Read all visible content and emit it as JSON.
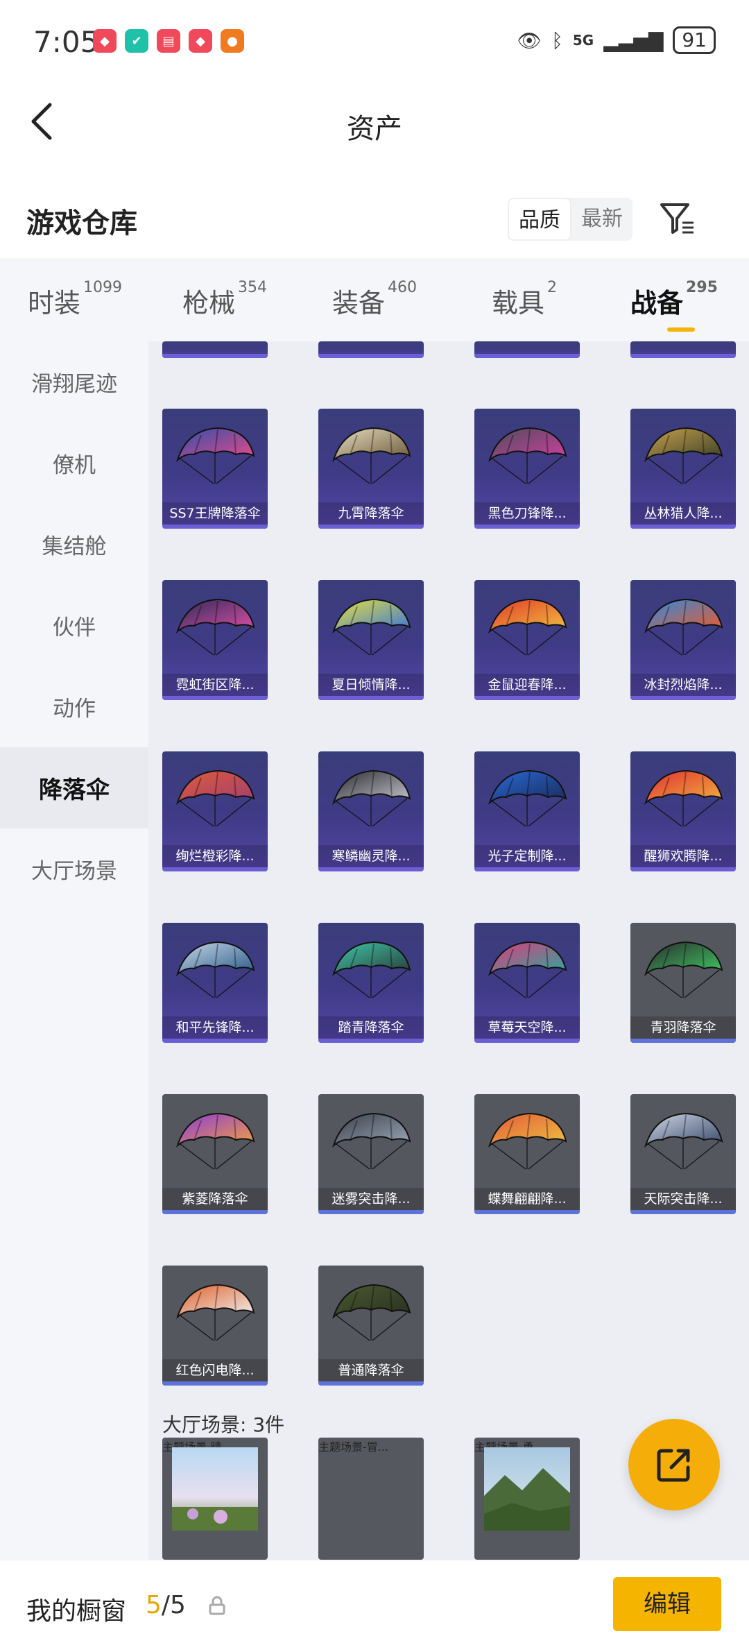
{
  "status": {
    "time": "7:05",
    "network": "5G",
    "battery": "91"
  },
  "nav": {
    "title": "资产"
  },
  "warehouse": {
    "title": "游戏仓库",
    "sort_quality": "品质",
    "sort_newest": "最新"
  },
  "tabs": [
    {
      "label": "时装",
      "count": "1099"
    },
    {
      "label": "枪械",
      "count": "354"
    },
    {
      "label": "装备",
      "count": "460"
    },
    {
      "label": "载具",
      "count": "2"
    },
    {
      "label": "战备",
      "count": "295"
    }
  ],
  "sidebar": [
    "滑翔尾迹",
    "僚机",
    "集结舱",
    "伙伴",
    "动作",
    "降落伞",
    "大厅场景"
  ],
  "items": [
    {
      "name": "SS7王牌降落伞",
      "style": "purple",
      "c1": "#2f4fa8",
      "c2": "#e84b8a"
    },
    {
      "name": "九霄降落伞",
      "style": "purple",
      "c1": "#e8dcc0",
      "c2": "#6b5a3a"
    },
    {
      "name": "黑色刀锋降...",
      "style": "purple",
      "c1": "#4a4f5a",
      "c2": "#d03ea0"
    },
    {
      "name": "丛林猎人降...",
      "style": "purple",
      "c1": "#c8a24a",
      "c2": "#3a3f2a"
    },
    {
      "name": "霓虹街区降...",
      "style": "purple",
      "c1": "#2a2a55",
      "c2": "#e050a8"
    },
    {
      "name": "夏日倾情降...",
      "style": "purple",
      "c1": "#e8e040",
      "c2": "#3a78d8"
    },
    {
      "name": "金鼠迎春降...",
      "style": "purple",
      "c1": "#e03a2a",
      "c2": "#f0c040"
    },
    {
      "name": "冰封烈焰降...",
      "style": "purple",
      "c1": "#2a8ae0",
      "c2": "#f05a2a"
    },
    {
      "name": "绚烂橙彩降...",
      "style": "purple",
      "c1": "#e05a3a",
      "c2": "#a04070"
    },
    {
      "name": "寒鳞幽灵降...",
      "style": "purple",
      "c1": "#2a2a30",
      "c2": "#c8c8d0"
    },
    {
      "name": "光子定制降...",
      "style": "purple",
      "c1": "#2a6ad8",
      "c2": "#1a2a58"
    },
    {
      "name": "醒狮欢腾降...",
      "style": "purple",
      "c1": "#e03030",
      "c2": "#f0b040"
    },
    {
      "name": "和平先锋降...",
      "style": "purple",
      "c1": "#c8d8e8",
      "c2": "#2a5a8a"
    },
    {
      "name": "踏青降落伞",
      "style": "purple",
      "c1": "#40c8a8",
      "c2": "#2a3a3a"
    },
    {
      "name": "草莓天空降...",
      "style": "purple",
      "c1": "#e03a7a",
      "c2": "#2aa8a0"
    },
    {
      "name": "青羽降落伞",
      "style": "gray",
      "c1": "#2a2a30",
      "c2": "#40c860"
    },
    {
      "name": "紫菱降落伞",
      "style": "gray",
      "c1": "#8a3ad8",
      "c2": "#f0a040"
    },
    {
      "name": "迷雾突击降...",
      "style": "gray",
      "c1": "#3a3f48",
      "c2": "#9aa8b8"
    },
    {
      "name": "蝶舞翩翩降...",
      "style": "gray",
      "c1": "#e05a3a",
      "c2": "#f0c040"
    },
    {
      "name": "天际突击降...",
      "style": "gray",
      "c1": "#d0d8e8",
      "c2": "#3a4a6a"
    },
    {
      "name": "红色闪电降...",
      "style": "gray",
      "c1": "#e0602a",
      "c2": "#f0f0f0"
    },
    {
      "name": "普通降落伞",
      "style": "gray",
      "c1": "#4a5a30",
      "c2": "#2a3020"
    }
  ],
  "scene_section": {
    "title": "大厅场景: 3件"
  },
  "scenes": [
    "主题场景-晴...",
    "主题场景-冒...",
    "主题场景-勇..."
  ],
  "bottom": {
    "showcase_label": "我的橱窗",
    "showcase_current": "5",
    "showcase_total": "/5",
    "edit_label": "编辑"
  },
  "colors": {
    "accent": "#f5b400",
    "card_purple": "#3f3b86",
    "card_gray": "#55575e"
  }
}
